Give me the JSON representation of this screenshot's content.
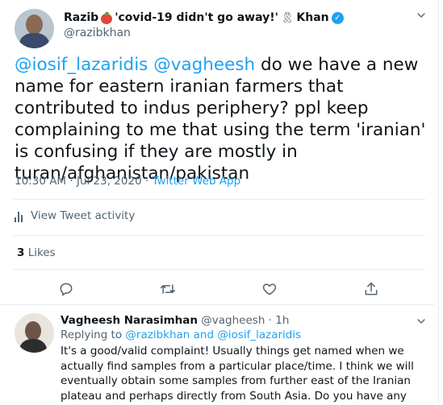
{
  "tweet": {
    "display_name_first": "Razib",
    "display_name_quote": "'covid-19 didn't go away!'",
    "display_name_last": "Khan",
    "handle": "@razibkhan",
    "verified_icon": "verified-badge-icon",
    "more_icon": "more-icon",
    "mention_1": "@iosif_lazaridis",
    "mention_2": "@vagheesh",
    "text_rest": " do we have a new name for eastern iranian farmers that contributed to indus periphery? ppl keep complaining to me that using the term 'iranian' is confusing if they are mostly in turan/afghanistan/pakistan",
    "time": "10:30 AM",
    "separator": " · ",
    "date": "Jul 23, 2020",
    "app": "Twitter Web App",
    "activity_label": "View Tweet activity",
    "likes_count": "3",
    "likes_label": "Likes"
  },
  "actions": [
    "reply-icon",
    "retweet-icon",
    "like-icon",
    "share-icon"
  ],
  "reply": {
    "name": "Vagheesh Narasimhan",
    "handle": "@vagheesh",
    "separator": " · ",
    "age": "1h",
    "replying_prefix": "Replying to ",
    "replying_1": "@razibkhan",
    "replying_and": " and ",
    "replying_2": "@iosif_lazaridis",
    "text": "It's a good/valid complaint! Usually things get named when we actually find samples from a particular place/time. I think we will eventually obtain some samples from further east of the Iranian plateau and perhaps directly from South Asia. Do you have any suggested names for now?"
  },
  "colors": {
    "accent": "#1da1f2",
    "text_primary": "#0f1419",
    "text_secondary": "#536471",
    "divider": "#e6ecf0"
  }
}
